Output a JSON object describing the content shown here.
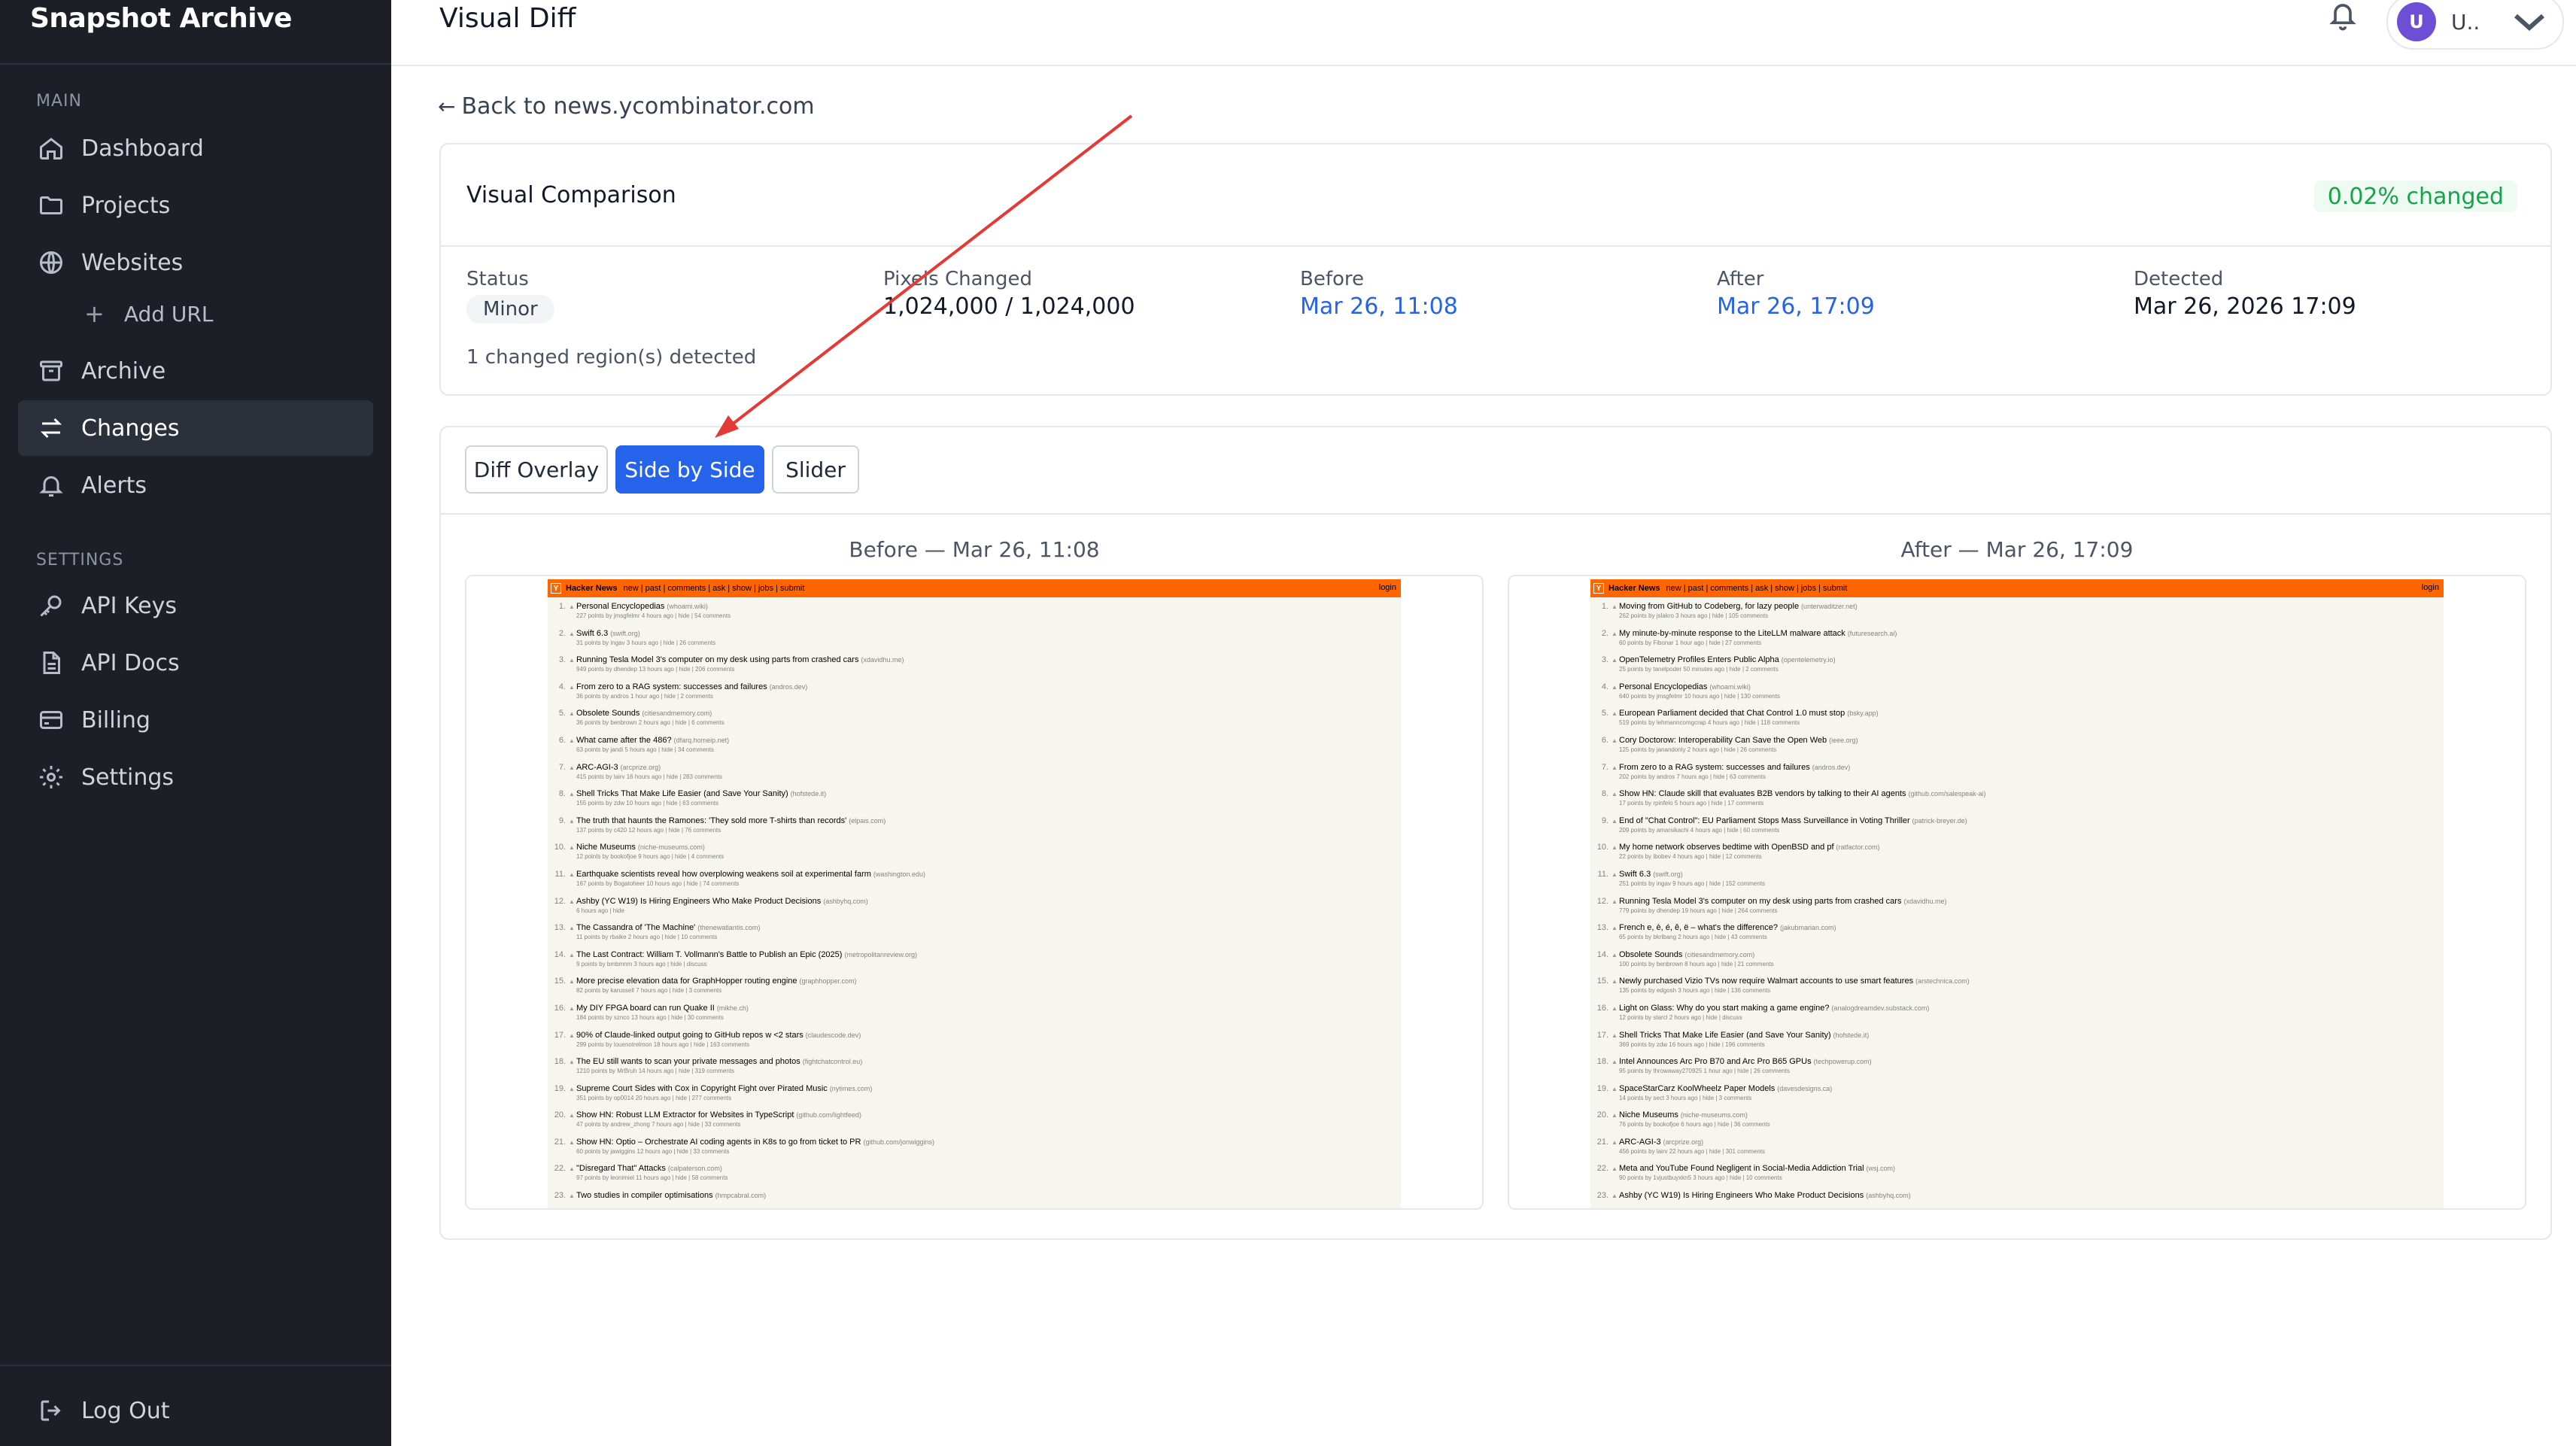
{
  "sidebar": {
    "brand": "Snapshot Archive",
    "main_label": "MAIN",
    "settings_label": "SETTINGS",
    "items": [
      {
        "label": "Dashboard",
        "icon": "home-icon"
      },
      {
        "label": "Projects",
        "icon": "folder-icon"
      },
      {
        "label": "Websites",
        "icon": "globe-icon"
      },
      {
        "label": "Add URL",
        "icon": "plus-icon"
      },
      {
        "label": "Archive",
        "icon": "archive-icon"
      },
      {
        "label": "Changes",
        "icon": "arrows-exchange-icon",
        "active": true
      },
      {
        "label": "Alerts",
        "icon": "bell-icon"
      }
    ],
    "settings_items": [
      {
        "label": "API Keys",
        "icon": "key-icon"
      },
      {
        "label": "API Docs",
        "icon": "document-icon"
      },
      {
        "label": "Billing",
        "icon": "credit-card-icon"
      },
      {
        "label": "Settings",
        "icon": "gear-icon"
      }
    ],
    "logout": "Log Out"
  },
  "header": {
    "title": "Visual Diff",
    "user_initial": "U",
    "user_name": "U.."
  },
  "back_link": "Back to news.ycombinator.com",
  "comparison": {
    "title": "Visual Comparison",
    "changed_pct": "0.02% changed",
    "status_label": "Status",
    "status_value": "Minor",
    "pixels_label": "Pixels Changed",
    "pixels_value": "1,024,000 / 1,024,000",
    "before_label": "Before",
    "before_value": "Mar 26, 11:08",
    "after_label": "After",
    "after_value": "Mar 26, 17:09",
    "detected_label": "Detected",
    "detected_value": "Mar 26, 2026 17:09",
    "regions_text": "1 changed region(s) detected"
  },
  "tabs": {
    "diff_overlay": "Diff Overlay",
    "side_by_side": "Side by Side",
    "slider": "Slider"
  },
  "before_panel": {
    "title": "Before — Mar 26, 11:08",
    "hn_header": {
      "name": "Hacker News",
      "nav": "new | past | comments | ask | show | jobs | submit",
      "login": "login"
    },
    "items": [
      {
        "rank": "1.",
        "title": "Personal Encyclopedias",
        "site": "(whoami.wiki)",
        "sub": "227 points by jmsgfelmr 4 hours ago | hide | 54 comments"
      },
      {
        "rank": "2.",
        "title": "Swift 6.3",
        "site": "(swift.org)",
        "sub": "31 points by ingav 3 hours ago | hide | 26 comments"
      },
      {
        "rank": "3.",
        "title": "Running Tesla Model 3's computer on my desk using parts from crashed cars",
        "site": "(xdavidhu.me)",
        "sub": "949 points by dhendep 13 hours ago | hide | 206 comments"
      },
      {
        "rank": "4.",
        "title": "From zero to a RAG system: successes and failures",
        "site": "(andros.dev)",
        "sub": "36 points by andros 1 hour ago | hide | 2 comments"
      },
      {
        "rank": "5.",
        "title": "Obsolete Sounds",
        "site": "(citiesandmemory.com)",
        "sub": "36 points by benbrown 2 hours ago | hide | 6 comments"
      },
      {
        "rank": "6.",
        "title": "What came after the 486?",
        "site": "(dfarq.homeip.net)",
        "sub": "63 points by jandi 5 hours ago | hide | 34 comments"
      },
      {
        "rank": "7.",
        "title": "ARC-AGI-3",
        "site": "(arcprize.org)",
        "sub": "415 points by lairv 16 hours ago | hide | 283 comments"
      },
      {
        "rank": "8.",
        "title": "Shell Tricks That Make Life Easier (and Save Your Sanity)",
        "site": "(hofstede.it)",
        "sub": "155 points by zdw 10 hours ago | hide | 63 comments"
      },
      {
        "rank": "9.",
        "title": "The truth that haunts the Ramones: 'They sold more T-shirts than records'",
        "site": "(elpais.com)",
        "sub": "137 points by c420 12 hours ago | hide | 76 comments"
      },
      {
        "rank": "10.",
        "title": "Niche Museums",
        "site": "(niche-museums.com)",
        "sub": "12 points by bookofjoe 9 hours ago | hide | 4 comments"
      },
      {
        "rank": "11.",
        "title": "Earthquake scientists reveal how overplowing weakens soil at experimental farm",
        "site": "(washington.edu)",
        "sub": "167 points by Bogatoheer 10 hours ago | hide | 74 comments"
      },
      {
        "rank": "12.",
        "title": "Ashby (YC W19) Is Hiring Engineers Who Make Product Decisions",
        "site": "(ashbyhq.com)",
        "sub": "6 hours ago | hide"
      },
      {
        "rank": "13.",
        "title": "The Cassandra of 'The Machine'",
        "site": "(thenewatlantis.com)",
        "sub": "11 points by rbaike 2 hours ago | hide | 10 comments"
      },
      {
        "rank": "14.",
        "title": "The Last Contract: William T. Vollmann's Battle to Publish an Epic (2025)",
        "site": "(metropolitanreview.org)",
        "sub": "9 points by bmbmnm 3 hours ago | hide | discuss"
      },
      {
        "rank": "15.",
        "title": "More precise elevation data for GraphHopper routing engine",
        "site": "(graphhopper.com)",
        "sub": "82 points by karussell 7 hours ago | hide | 3 comments"
      },
      {
        "rank": "16.",
        "title": "My DIY FPGA board can run Quake II",
        "site": "(mikhe.ch)",
        "sub": "184 points by sznco 13 hours ago | hide | 30 comments"
      },
      {
        "rank": "17.",
        "title": "90% of Claude-linked output going to GitHub repos w <2 stars",
        "site": "(claudescode.dev)",
        "sub": "299 points by louenotrelmon 18 hours ago | hide | 163 comments"
      },
      {
        "rank": "18.",
        "title": "The EU still wants to scan your private messages and photos",
        "site": "(fightchatcontrol.eu)",
        "sub": "1210 points by MrBruh 14 hours ago | hide | 319 comments"
      },
      {
        "rank": "19.",
        "title": "Supreme Court Sides with Cox in Copyright Fight over Pirated Music",
        "site": "(nytimes.com)",
        "sub": "351 points by op0014 20 hours ago | hide | 277 comments"
      },
      {
        "rank": "20.",
        "title": "Show HN: Robust LLM Extractor for Websites in TypeScript",
        "site": "(github.com/lightfeed)",
        "sub": "47 points by andrew_zhong 7 hours ago | hide | 33 comments"
      },
      {
        "rank": "21.",
        "title": "Show HN: Optio – Orchestrate AI coding agents in K8s to go from ticket to PR",
        "site": "(github.com/jonwiggins)",
        "sub": "60 points by jawiggins 12 hours ago | hide | 33 comments"
      },
      {
        "rank": "22.",
        "title": "\"Disregard That\" Attacks",
        "site": "(calpaterson.com)",
        "sub": "97 points by leonimiel 11 hours ago | hide | 58 comments"
      },
      {
        "rank": "23.",
        "title": "Two studies in compiler optimisations",
        "site": "(hmpcabral.com)",
        "sub": ""
      }
    ]
  },
  "after_panel": {
    "title": "After — Mar 26, 17:09",
    "hn_header": {
      "name": "Hacker News",
      "nav": "new | past | comments | ask | show | jobs | submit",
      "login": "login"
    },
    "items": [
      {
        "rank": "1.",
        "title": "Moving from GitHub to Codeberg, for lazy people",
        "site": "(unterwaditzer.net)",
        "sub": "262 points by jslakro 3 hours ago | hide | 105 comments"
      },
      {
        "rank": "2.",
        "title": "My minute-by-minute response to the LiteLLM malware attack",
        "site": "(futuresearch.ai)",
        "sub": "60 points by Fibonar 1 hour ago | hide | 27 comments"
      },
      {
        "rank": "3.",
        "title": "OpenTelemetry Profiles Enters Public Alpha",
        "site": "(opentelemetry.io)",
        "sub": "25 points by tanelpoder 50 minutes ago | hide | 2 comments"
      },
      {
        "rank": "4.",
        "title": "Personal Encyclopedias",
        "site": "(whoami.wiki)",
        "sub": "640 points by jmsgfelmr 10 hours ago | hide | 130 comments"
      },
      {
        "rank": "5.",
        "title": "European Parliament decided that Chat Control 1.0 must stop",
        "site": "(bsky.app)",
        "sub": "519 points by lehmanncomgcrap 4 hours ago | hide | 118 comments"
      },
      {
        "rank": "6.",
        "title": "Cory Doctorow: Interoperability Can Save the Open Web",
        "site": "(ieee.org)",
        "sub": "125 points by janandonly 2 hours ago | hide | 26 comments"
      },
      {
        "rank": "7.",
        "title": "From zero to a RAG system: successes and failures",
        "site": "(andros.dev)",
        "sub": "202 points by andros 7 hours ago | hide | 63 comments"
      },
      {
        "rank": "8.",
        "title": "Show HN: Claude skill that evaluates B2B vendors by talking to their AI agents",
        "site": "(github.com/salespeak-ai)",
        "sub": "17 points by rpinfelo 5 hours ago | hide | 17 comments"
      },
      {
        "rank": "9.",
        "title": "End of \"Chat Control\": EU Parliament Stops Mass Surveillance in Voting Thriller",
        "site": "(patrick-breyer.de)",
        "sub": "209 points by amarsikachi 4 hours ago | hide | 60 comments"
      },
      {
        "rank": "10.",
        "title": "My home network observes bedtime with OpenBSD and pf",
        "site": "(ratfactor.com)",
        "sub": "22 points by ibobev 4 hours ago | hide | 12 comments"
      },
      {
        "rank": "11.",
        "title": "Swift 6.3",
        "site": "(swift.org)",
        "sub": "251 points by ingav 9 hours ago | hide | 152 comments"
      },
      {
        "rank": "12.",
        "title": "Running Tesla Model 3's computer on my desk using parts from crashed cars",
        "site": "(xdavidhu.me)",
        "sub": "779 points by dhendep 19 hours ago | hide | 264 comments"
      },
      {
        "rank": "13.",
        "title": "French e, è, é, ê, ë – what's the difference?",
        "site": "(jakubmarian.com)",
        "sub": "65 points by bkrlbang 2 hours ago | hide | 43 comments"
      },
      {
        "rank": "14.",
        "title": "Obsolete Sounds",
        "site": "(citiesandmemory.com)",
        "sub": "100 points by benbrown 8 hours ago | hide | 21 comments"
      },
      {
        "rank": "15.",
        "title": "Newly purchased Vizio TVs now require Walmart accounts to use smart features",
        "site": "(arstechnica.com)",
        "sub": "135 points by edgosh 3 hours ago | hide | 136 comments"
      },
      {
        "rank": "16.",
        "title": "Light on Glass: Why do you start making a game engine?",
        "site": "(analogdreamdev.substack.com)",
        "sub": "12 points by starcl 2 hours ago | hide | discuss"
      },
      {
        "rank": "17.",
        "title": "Shell Tricks That Make Life Easier (and Save Your Sanity)",
        "site": "(hofstede.it)",
        "sub": "369 points by zdw 16 hours ago | hide | 196 comments"
      },
      {
        "rank": "18.",
        "title": "Intel Announces Arc Pro B70 and Arc Pro B65 GPUs",
        "site": "(techpowerup.com)",
        "sub": "95 points by throwaway270925 1 hour ago | hide | 26 comments"
      },
      {
        "rank": "19.",
        "title": "SpaceStarCarz KoolWheelz Paper Models",
        "site": "(davesdesigns.ca)",
        "sub": "14 points by sect 3 hours ago | hide | 3 comments"
      },
      {
        "rank": "20.",
        "title": "Niche Museums",
        "site": "(niche-museums.com)",
        "sub": "76 points by bookofjoe 6 hours ago | hide | 36 comments"
      },
      {
        "rank": "21.",
        "title": "ARC-AGI-3",
        "site": "(arcprize.org)",
        "sub": "456 points by lairv 22 hours ago | hide | 301 comments"
      },
      {
        "rank": "22.",
        "title": "Meta and YouTube Found Negligent in Social-Media Addiction Trial",
        "site": "(wsj.com)",
        "sub": "90 points by 1vjustbuyxkn5 3 hours ago | hide | 10 comments"
      },
      {
        "rank": "23.",
        "title": "Ashby (YC W19) Is Hiring Engineers Who Make Product Decisions",
        "site": "(ashbyhq.com)",
        "sub": ""
      }
    ]
  },
  "colors": {
    "sidebar_bg": "#1c1f26",
    "accent_blue": "#2563eb",
    "success_green": "#16a34a",
    "hn_orange": "#ff6600",
    "annotation_red": "#e53935"
  }
}
